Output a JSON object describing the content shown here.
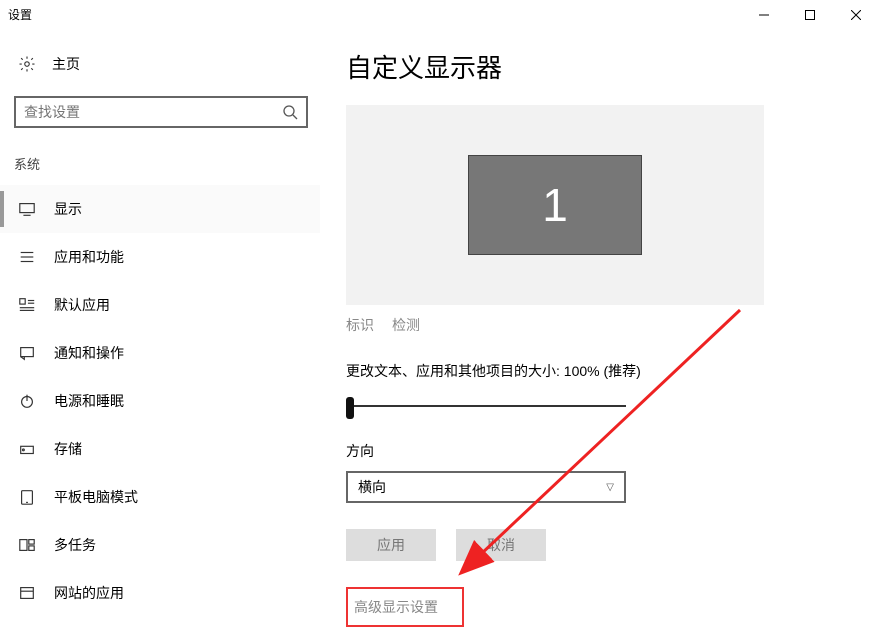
{
  "window": {
    "title": "设置"
  },
  "sidebar": {
    "home": "主页",
    "search_placeholder": "查找设置",
    "section": "系统",
    "items": [
      {
        "label": "显示"
      },
      {
        "label": "应用和功能"
      },
      {
        "label": "默认应用"
      },
      {
        "label": "通知和操作"
      },
      {
        "label": "电源和睡眠"
      },
      {
        "label": "存储"
      },
      {
        "label": "平板电脑模式"
      },
      {
        "label": "多任务"
      },
      {
        "label": "网站的应用"
      }
    ]
  },
  "main": {
    "heading": "自定义显示器",
    "monitor_number": "1",
    "link_identify": "标识",
    "link_detect": "检测",
    "scale_label": "更改文本、应用和其他项目的大小: 100% (推荐)",
    "orientation_label": "方向",
    "orientation_value": "横向",
    "btn_apply": "应用",
    "btn_cancel": "取消",
    "advanced_link": "高级显示设置"
  }
}
